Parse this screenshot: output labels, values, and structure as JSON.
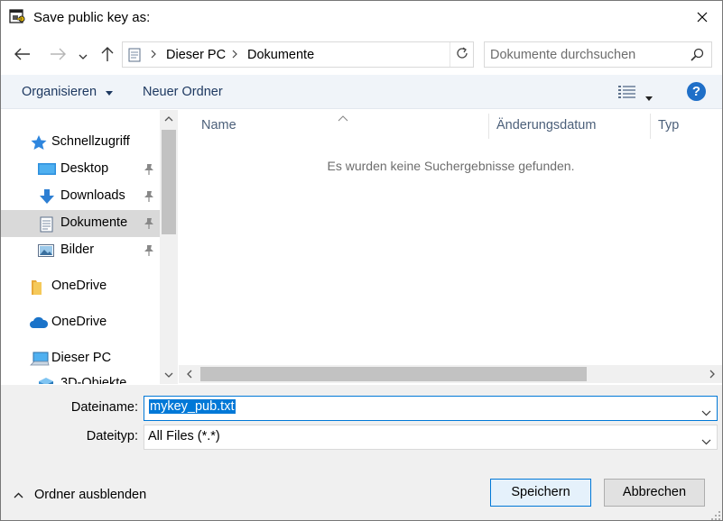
{
  "window": {
    "title": "Save public key as:"
  },
  "address": {
    "crumbs": [
      "Dieser PC",
      "Dokumente"
    ],
    "search_placeholder": "Dokumente durchsuchen"
  },
  "toolbar": {
    "organize_label": "Organisieren",
    "new_folder_label": "Neuer Ordner",
    "help_glyph": "?"
  },
  "navpane": {
    "items": [
      {
        "label": "Schnellzugriff",
        "icon": "star-icon"
      },
      {
        "label": "Desktop",
        "icon": "desktop-icon",
        "pinned": true
      },
      {
        "label": "Downloads",
        "icon": "download-arrow-icon",
        "pinned": true
      },
      {
        "label": "Dokumente",
        "icon": "document-icon",
        "pinned": true,
        "selected": true
      },
      {
        "label": "Bilder",
        "icon": "picture-icon",
        "pinned": true
      },
      {
        "label": "OneDrive",
        "icon": "folder-icon"
      },
      {
        "label": "OneDrive",
        "icon": "cloud-icon"
      },
      {
        "label": "Dieser PC",
        "icon": "computer-icon"
      },
      {
        "label": "3D-Objekte",
        "icon": "cube-icon"
      }
    ]
  },
  "filelist": {
    "columns": [
      "Name",
      "Änderungsdatum",
      "Typ"
    ],
    "empty_message": "Es wurden keine Suchergebnisse gefunden."
  },
  "form": {
    "filename_label": "Dateiname:",
    "filename_value": "mykey_pub.txt",
    "filetype_label": "Dateityp:",
    "filetype_value": "All Files (*.*)",
    "hide_folders_label": "Ordner ausblenden",
    "save_label": "Speichern",
    "cancel_label": "Abbrechen"
  },
  "colors": {
    "accent": "#0078d7",
    "toolbar_bg": "#f0f4f9",
    "selected_bg": "#d9d9d9",
    "panel_bg": "#f0f0f0"
  }
}
